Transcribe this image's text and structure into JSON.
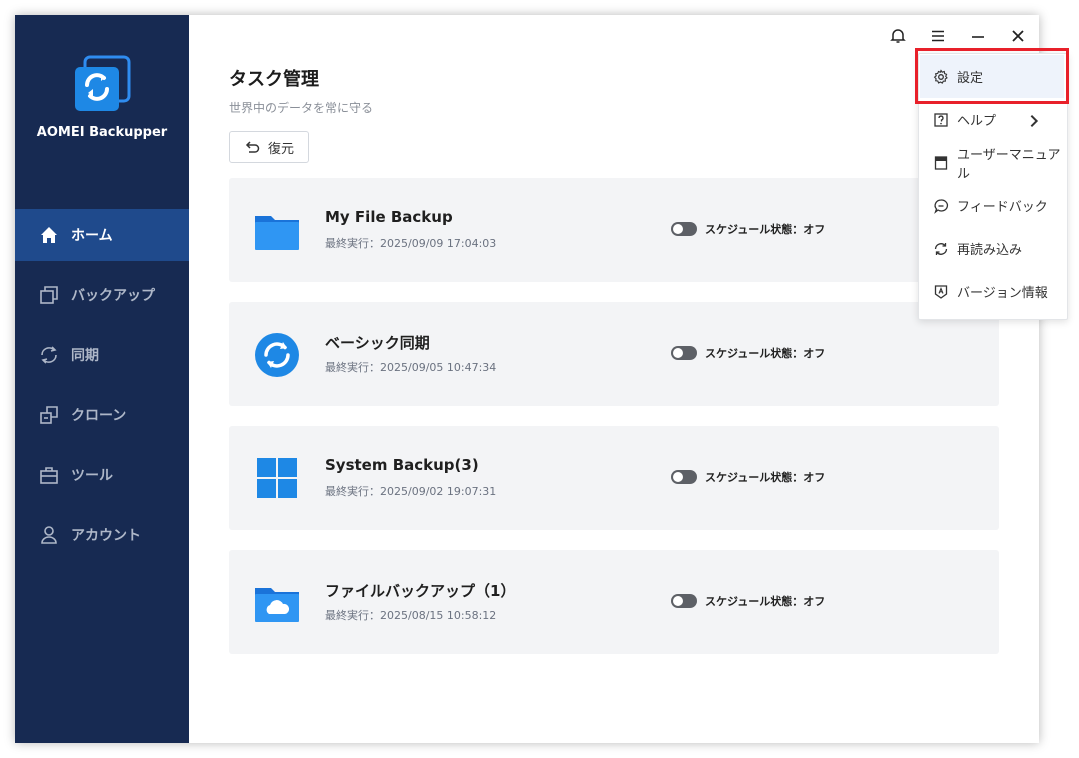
{
  "app": {
    "name": "AOMEI Backupper"
  },
  "sidebar": {
    "items": [
      {
        "label": "ホーム",
        "icon": "home-icon"
      },
      {
        "label": "バックアップ",
        "icon": "backup-icon"
      },
      {
        "label": "同期",
        "icon": "sync-icon"
      },
      {
        "label": "クローン",
        "icon": "clone-icon"
      },
      {
        "label": "ツール",
        "icon": "toolbox-icon"
      },
      {
        "label": "アカウント",
        "icon": "user-icon"
      }
    ],
    "active_index": 0
  },
  "main": {
    "title": "タスク管理",
    "subtitle": "世界中のデータを常に守る",
    "restore_label": "復元"
  },
  "tasks": [
    {
      "name": "My File Backup",
      "last_run": "最終実行：2025/09/09 17:04:03",
      "schedule": "スケジュール状態：オフ",
      "icon": "folder-icon"
    },
    {
      "name": "ベーシック同期",
      "last_run": "最終実行：2025/09/05 10:47:34",
      "schedule": "スケジュール状態：オフ",
      "icon": "sync-circle-icon"
    },
    {
      "name": "System Backup(3)",
      "last_run": "最終実行：2025/09/02 19:07:31",
      "schedule": "スケジュール状態：オフ",
      "icon": "windows-icon"
    },
    {
      "name": "ファイルバックアップ（1）",
      "last_run": "最終実行：2025/08/15 10:58:12",
      "schedule": "スケジュール状態：オフ",
      "icon": "cloud-folder-icon"
    }
  ],
  "menu": {
    "items": [
      {
        "label": "設定",
        "icon": "gear-icon"
      },
      {
        "label": "ヘルプ",
        "icon": "help-icon"
      },
      {
        "label": "ユーザーマニュアル",
        "icon": "manual-icon"
      },
      {
        "label": "フィードバック",
        "icon": "feedback-icon"
      },
      {
        "label": "再読み込み",
        "icon": "refresh-icon"
      },
      {
        "label": "バージョン情報",
        "icon": "version-icon"
      }
    ],
    "highlighted_index": 0
  },
  "colors": {
    "sidebar_bg": "#172a52",
    "sidebar_active": "#1f4a8c",
    "accent_blue": "#1e88e5",
    "highlight_red": "#e8202a"
  }
}
